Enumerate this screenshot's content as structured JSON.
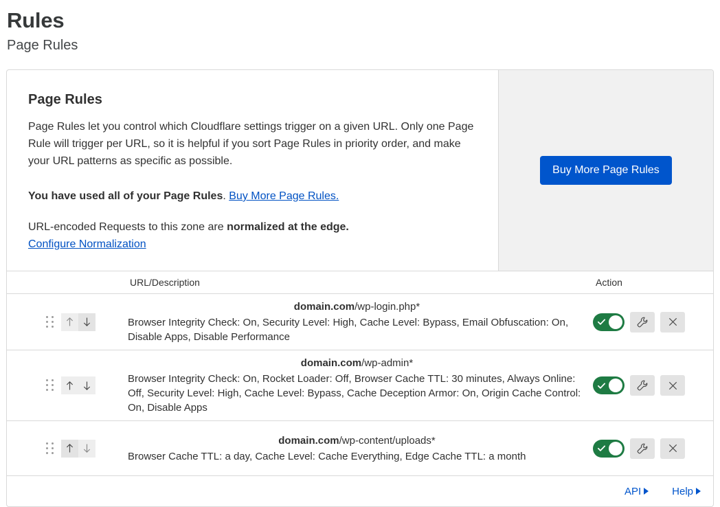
{
  "header": {
    "title": "Rules",
    "subtitle": "Page Rules"
  },
  "intro": {
    "heading": "Page Rules",
    "body": "Page Rules let you control which Cloudflare settings trigger on a given URL. Only one Page Rule will trigger per URL, so it is helpful if you sort Page Rules in priority order, and make your URL patterns as specific as possible.",
    "quota_text": "You have used all of your Page Rules",
    "quota_period": ".",
    "quota_link": "Buy More Page Rules.",
    "normalize_prefix": "URL-encoded Requests to this zone are ",
    "normalize_bold": "normalized at the edge.",
    "normalize_link": "Configure Normalization",
    "buy_button": "Buy More Page Rules",
    "buy_button_color": "#0055cc",
    "panel_bg": "#f1f1f1"
  },
  "table": {
    "headers": {
      "url": "URL/Description",
      "action": "Action"
    },
    "rows": [
      {
        "domain": "domain.com",
        "path": "/wp-login.php*",
        "description": "Browser Integrity Check: On, Security Level: High, Cache Level: Bypass, Email Obfuscation: On, Disable Apps, Disable Performance",
        "enabled": true,
        "up_enabled": false,
        "down_enabled": true
      },
      {
        "domain": "domain.com",
        "path": "/wp-admin*",
        "description": "Browser Integrity Check: On, Rocket Loader: Off, Browser Cache TTL: 30 minutes, Always Online: Off, Security Level: High, Cache Level: Bypass, Cache Deception Armor: On, Origin Cache Control: On, Disable Apps",
        "enabled": true,
        "up_enabled": true,
        "down_enabled": true
      },
      {
        "domain": "domain.com",
        "path": "/wp-content/uploads*",
        "description": "Browser Cache TTL: a day, Cache Level: Cache Everything, Edge Cache TTL: a month",
        "enabled": true,
        "up_enabled": true,
        "down_enabled": false
      }
    ],
    "toggle_color": "#1e7b43"
  },
  "footer": {
    "api_label": "API",
    "help_label": "Help",
    "link_color": "#0055cc"
  }
}
